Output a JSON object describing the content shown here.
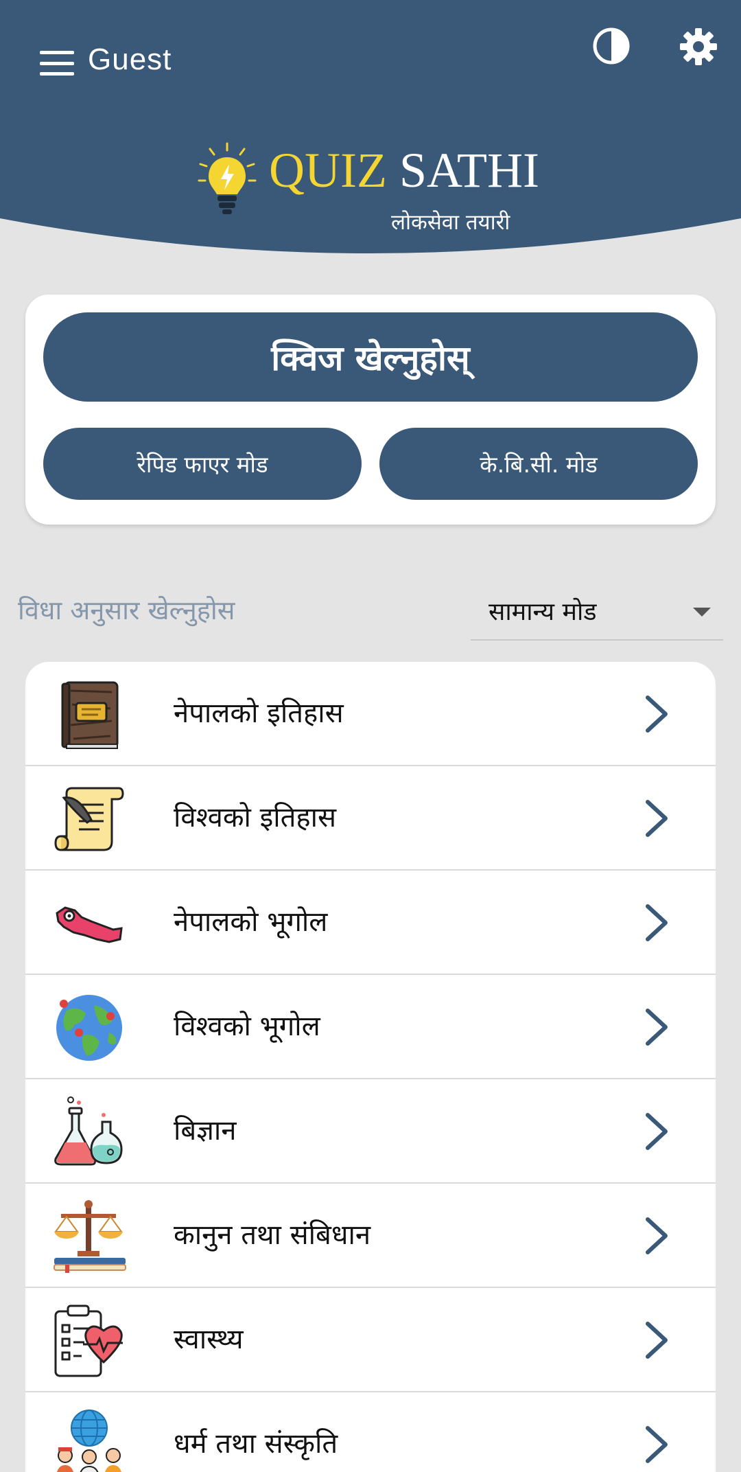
{
  "header": {
    "user_name": "Guest",
    "brand_quiz": "QUIZ",
    "brand_sathi": "SATHI",
    "tagline": "लोकसेवा तयारी",
    "menu_icon": "hamburger-menu-icon",
    "theme_icon": "contrast-icon",
    "settings_icon": "gear-icon",
    "logo_icon": "lightbulb-icon",
    "colors": {
      "primary": "#3a5878",
      "accent": "#f4d531"
    }
  },
  "play": {
    "main_label": "क्विज खेल्नुहोस्",
    "rapid_label": "रेपिड फाएर मोड",
    "kbc_label": "के.बि.सी. मोड"
  },
  "subjects_section": {
    "label": "विधा अनुसार खेल्नुहोस",
    "mode_value": "सामान्य मोड"
  },
  "subjects": [
    {
      "label": "नेपालको इतिहास",
      "icon": "old-book-icon"
    },
    {
      "label": "विश्वको इतिहास",
      "icon": "scroll-quill-icon"
    },
    {
      "label": "नेपालको भूगोल",
      "icon": "nepal-map-icon"
    },
    {
      "label": "विश्वको भूगोल",
      "icon": "globe-icon"
    },
    {
      "label": "बिज्ञान",
      "icon": "flasks-icon"
    },
    {
      "label": "कानुन तथा संबिधान",
      "icon": "justice-scale-icon"
    },
    {
      "label": "स्वास्थ्य",
      "icon": "health-clipboard-icon"
    },
    {
      "label": "धर्म तथा संस्कृति",
      "icon": "people-globe-icon"
    }
  ]
}
